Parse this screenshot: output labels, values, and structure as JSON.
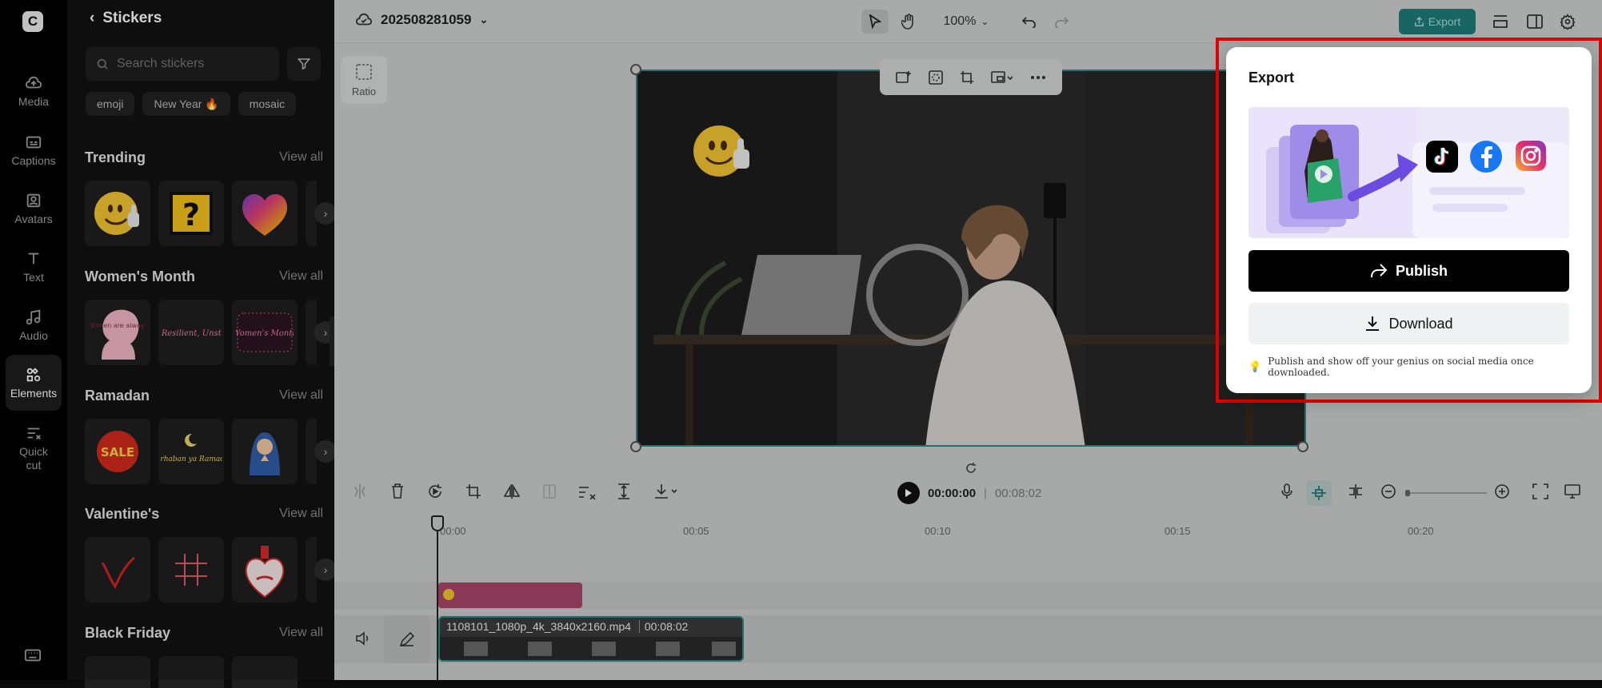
{
  "nav": {
    "items": [
      {
        "label": "Media",
        "icon": "media-icon"
      },
      {
        "label": "Captions",
        "icon": "captions-icon"
      },
      {
        "label": "Avatars",
        "icon": "avatars-icon"
      },
      {
        "label": "Text",
        "icon": "text-icon"
      },
      {
        "label": "Audio",
        "icon": "audio-icon"
      },
      {
        "label": "Elements",
        "icon": "elements-icon",
        "active": true
      },
      {
        "label_line1": "Quick",
        "label_line2": "cut",
        "icon": "quick-cut-icon"
      }
    ]
  },
  "stickers": {
    "title": "Stickers",
    "search_placeholder": "Search stickers",
    "chips": [
      "emoji",
      "New Year 🔥",
      "mosaic"
    ],
    "categories": [
      {
        "title": "Trending",
        "view_all": "View all"
      },
      {
        "title": "Women's Month",
        "view_all": "View all"
      },
      {
        "title": "Ramadan",
        "view_all": "View all"
      },
      {
        "title": "Valentine's",
        "view_all": "View all"
      },
      {
        "title": "Black Friday",
        "view_all": "View all"
      }
    ],
    "sticker_texts": {
      "womens_1": "Women are always",
      "womens_2": "Strong, Resilient, Unstoppable",
      "womens_3": "Women's Month",
      "ramadan_sale": "SALE",
      "ramadan_text": "Marhaban ya Ramadan"
    }
  },
  "topbar": {
    "project_name": "202508281059",
    "zoom": "100%",
    "export_label": "Export"
  },
  "canvas": {
    "ratio_label": "Ratio"
  },
  "timeline": {
    "current_time": "00:00:00",
    "separator": "|",
    "total_time": "00:08:02",
    "ruler_ticks": [
      "00:00",
      "00:05",
      "00:10",
      "00:15",
      "00:20"
    ],
    "video_clip_name": "1108101_1080p_4k_3840x2160.mp4",
    "video_clip_duration": "00:08:02"
  },
  "export_popover": {
    "title": "Export",
    "publish_label": "Publish",
    "download_label": "Download",
    "tip": "Publish and show off your genius on social media once downloaded.",
    "platforms": [
      "tiktok-icon",
      "facebook-icon",
      "instagram-icon"
    ]
  },
  "colors": {
    "accent": "#1f7c7a",
    "highlight_frame": "#e50000"
  }
}
